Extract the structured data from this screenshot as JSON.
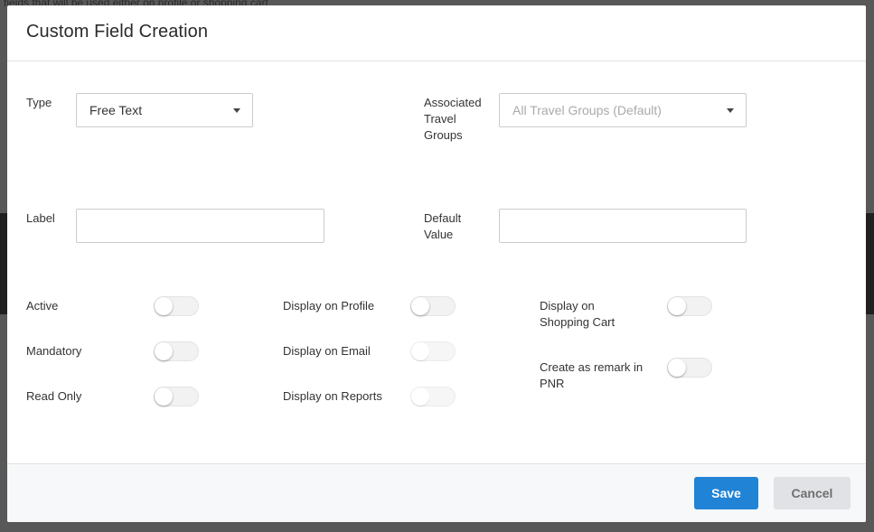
{
  "background": {
    "partial_text": "fields that will be used either on profile or shopping cart"
  },
  "modal": {
    "title": "Custom Field Creation"
  },
  "form": {
    "type": {
      "label": "Type",
      "value": "Free Text"
    },
    "groups": {
      "label": "Associated Travel Groups",
      "placeholder": "All Travel Groups (Default)"
    },
    "label_field": {
      "label": "Label",
      "value": ""
    },
    "default_value": {
      "label": "Default Value",
      "value": ""
    }
  },
  "toggles": {
    "active": {
      "label": "Active",
      "on": false,
      "enabled": true
    },
    "mandatory": {
      "label": "Mandatory",
      "on": false,
      "enabled": true
    },
    "read_only": {
      "label": "Read Only",
      "on": false,
      "enabled": true
    },
    "display_profile": {
      "label": "Display on Profile",
      "on": false,
      "enabled": true
    },
    "display_email": {
      "label": "Display on Email",
      "on": false,
      "enabled": false
    },
    "display_reports": {
      "label": "Display on Reports",
      "on": false,
      "enabled": false
    },
    "display_cart": {
      "label": "Display on Shopping Cart",
      "on": false,
      "enabled": true
    },
    "pnr_remark": {
      "label": "Create as remark in PNR",
      "on": false,
      "enabled": true
    }
  },
  "footer": {
    "save_label": "Save",
    "cancel_label": "Cancel"
  },
  "colors": {
    "primary": "#2083d6",
    "cancel": "#e0e2e5",
    "footer_bg": "#f7f8fa"
  }
}
